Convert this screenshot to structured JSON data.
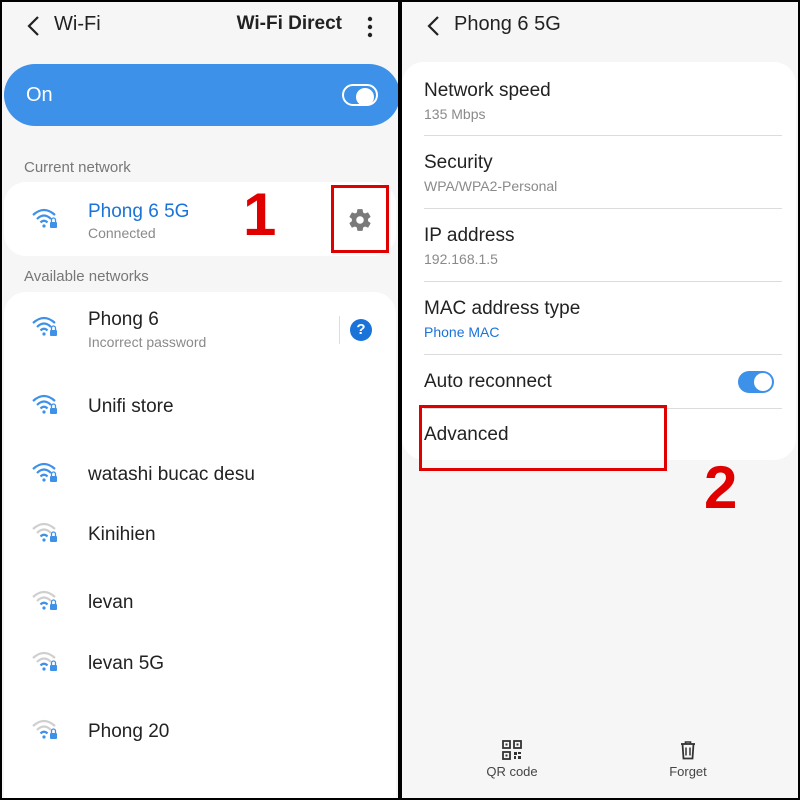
{
  "left": {
    "header": {
      "title": "Wi-Fi",
      "right_action": "Wi-Fi Direct"
    },
    "master": {
      "label": "On",
      "enabled": true
    },
    "current_label": "Current network",
    "current": {
      "name": "Phong 6 5G",
      "status": "Connected"
    },
    "available_label": "Available networks",
    "networks": [
      {
        "name": "Phong 6",
        "sub": "Incorrect password",
        "signal": "strong"
      },
      {
        "name": "Unifi store",
        "sub": "",
        "signal": "strong"
      },
      {
        "name": "watashi bucac desu",
        "sub": "",
        "signal": "strong"
      },
      {
        "name": "Kinihien",
        "sub": "",
        "signal": "weak"
      },
      {
        "name": "levan",
        "sub": "",
        "signal": "weak"
      },
      {
        "name": "levan 5G",
        "sub": "",
        "signal": "weak"
      },
      {
        "name": "Phong 20",
        "sub": "",
        "signal": "weak"
      }
    ],
    "step_label": "1"
  },
  "right": {
    "header": {
      "title": "Phong 6 5G"
    },
    "settings": [
      {
        "title": "Network speed",
        "sub": "135 Mbps"
      },
      {
        "title": "Security",
        "sub": "WPA/WPA2-Personal"
      },
      {
        "title": "IP address",
        "sub": "192.168.1.5"
      },
      {
        "title": "MAC address type",
        "sub": "Phone MAC"
      },
      {
        "title": "Auto reconnect",
        "sub": ""
      },
      {
        "title": "Advanced",
        "sub": ""
      }
    ],
    "auto_reconnect_enabled": true,
    "step_label": "2",
    "bottom": {
      "qr_label": "QR code",
      "forget_label": "Forget"
    }
  },
  "colors": {
    "accent": "#3e91e8",
    "link": "#1a73d9",
    "highlight": "#e00000"
  },
  "icons": [
    "back-arrow-icon",
    "more-options-icon",
    "wifi-lock-icon",
    "gear-icon",
    "help-icon",
    "qr-code-icon",
    "trash-icon"
  ]
}
